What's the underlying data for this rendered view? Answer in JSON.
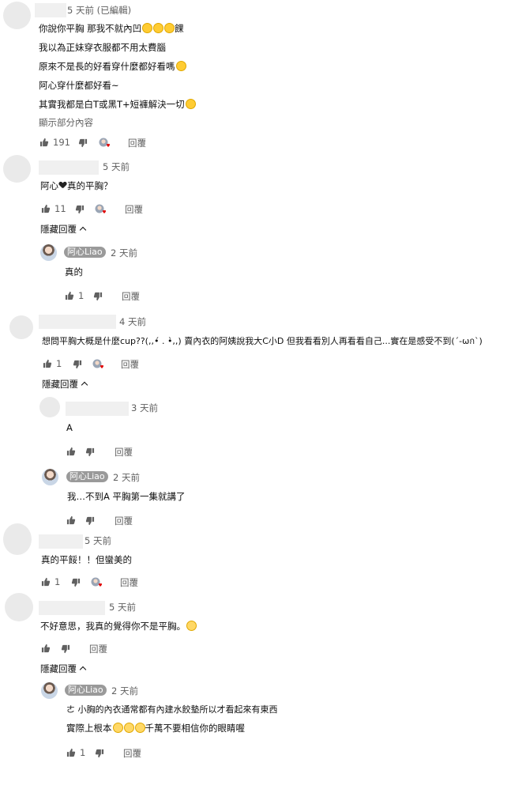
{
  "reply_label": "回覆",
  "hide_replies_label": "隱藏回覆",
  "owner_name": "阿心Liao",
  "comments": [
    {
      "time": "5 天前 (已編輯)",
      "lines": [
        "你說你平胸 那我不就內凹",
        "我以為正妹穿衣服都不用太費腦",
        "原來不是長的好看穿什麼都好看嗎",
        "阿心穿什麼都好看~",
        "其實我都是白T或黑T+短褲解決一切",
        "顯示部分內容"
      ],
      "trailing_text": "餜",
      "likes": "191"
    },
    {
      "time": "5 天前",
      "text_before": "阿心",
      "text_after": "真的平胸？",
      "likes": "11"
    },
    {
      "time": "2 天前",
      "text": "真的",
      "likes": "1"
    },
    {
      "time": "4 天前",
      "text": "想問平胸大概是什麼cup??(,,•́ . •̀,,) 賣內衣的阿姨說我大C小D 但我看看別人再看看自己...實在是感受不到(´-ωก`)",
      "likes": "1"
    },
    {
      "time": "3 天前",
      "text": "A"
    },
    {
      "time": "2 天前",
      "text": "我…不到A 平胸第一集就講了"
    },
    {
      "time": "5 天前",
      "text": "真的平餒！！但蠻美的",
      "likes": "1"
    },
    {
      "time": "5 天前",
      "text": "不好意思，我真的覺得你不是平胸。"
    },
    {
      "time": "2 天前",
      "lines": [
        "ㄜ 小胸的內衣通常都有內建水餃墊所以才看起來有東西",
        "實際上根本",
        "千萬不要相信你的眼睛喔"
      ],
      "likes": "1"
    }
  ]
}
